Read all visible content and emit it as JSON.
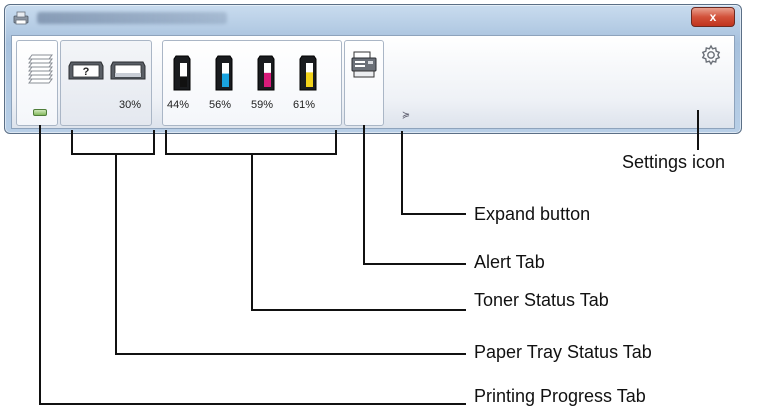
{
  "window": {
    "title": "",
    "close_glyph": "x"
  },
  "icons": {
    "app": "printer-app-icon",
    "printing_progress": "paper-stack-icon",
    "paper_tray_unknown": "paper-tray-unknown-icon",
    "paper_tray": "paper-tray-icon",
    "toner": "toner-cartridge-icon",
    "alert": "printer-alert-icon",
    "expand": "chevron-double-down-icon",
    "settings": "gear-icon"
  },
  "paper_tray": {
    "level_percent": "30%"
  },
  "toners": [
    {
      "color_name": "black",
      "hex": "#111111",
      "level_label": "44%",
      "level": 0.44
    },
    {
      "color_name": "cyan",
      "hex": "#1aa3df",
      "level_label": "56%",
      "level": 0.56
    },
    {
      "color_name": "magenta",
      "hex": "#d81b7a",
      "level_label": "59%",
      "level": 0.59
    },
    {
      "color_name": "yellow",
      "hex": "#f2d21b",
      "level_label": "61%",
      "level": 0.61
    }
  ],
  "expand_glyph": "≽",
  "callouts": {
    "settings_icon": "Settings icon",
    "expand_button": "Expand button",
    "alert_tab": "Alert Tab",
    "toner_status_tab": "Toner Status Tab",
    "paper_tray_status_tab": "Paper Tray Status Tab",
    "printing_progress_tab": "Printing Progress Tab"
  }
}
